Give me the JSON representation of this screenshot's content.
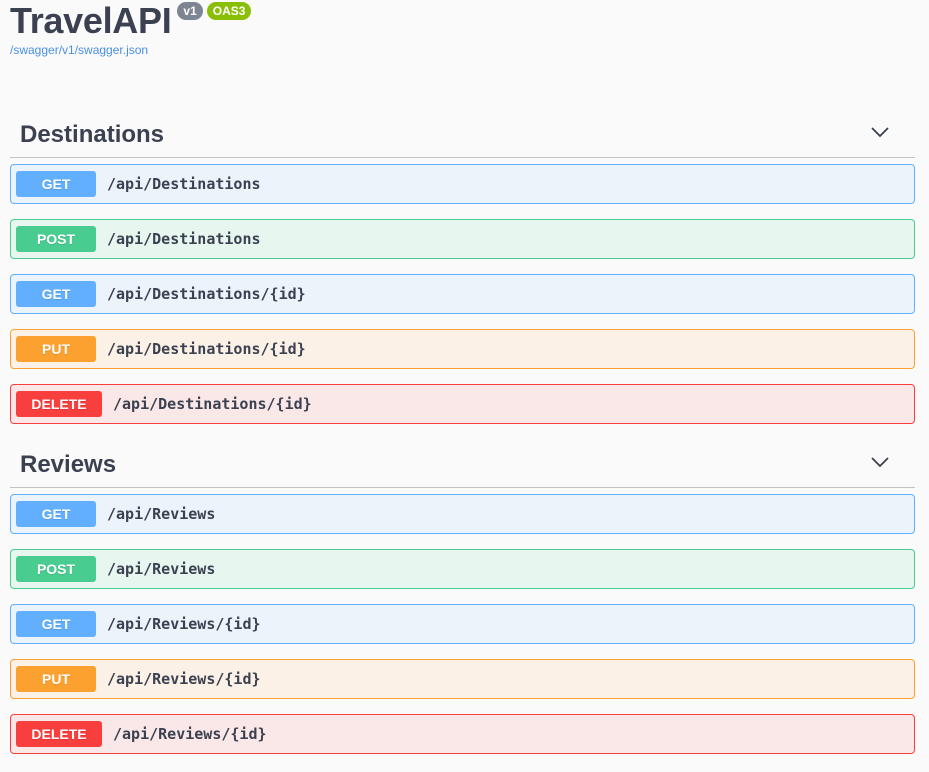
{
  "info": {
    "title": "TravelAPI",
    "version_badge": "v1",
    "oas_badge": "OAS3",
    "spec_link": "/swagger/v1/swagger.json"
  },
  "tags": [
    {
      "name": "Destinations",
      "operations": [
        {
          "method": "GET",
          "path": "/api/Destinations"
        },
        {
          "method": "POST",
          "path": "/api/Destinations"
        },
        {
          "method": "GET",
          "path": "/api/Destinations/{id}"
        },
        {
          "method": "PUT",
          "path": "/api/Destinations/{id}"
        },
        {
          "method": "DELETE",
          "path": "/api/Destinations/{id}"
        }
      ]
    },
    {
      "name": "Reviews",
      "operations": [
        {
          "method": "GET",
          "path": "/api/Reviews"
        },
        {
          "method": "POST",
          "path": "/api/Reviews"
        },
        {
          "method": "GET",
          "path": "/api/Reviews/{id}"
        },
        {
          "method": "PUT",
          "path": "/api/Reviews/{id}"
        },
        {
          "method": "DELETE",
          "path": "/api/Reviews/{id}"
        }
      ]
    }
  ],
  "colors": {
    "get": "#61affe",
    "post": "#49cc90",
    "put": "#fca130",
    "delete": "#f93e3e",
    "version_badge": "#7d8492",
    "oas_badge": "#89bf04",
    "link": "#4990e2"
  },
  "icons": {
    "collapse": "chevron-down-icon"
  }
}
